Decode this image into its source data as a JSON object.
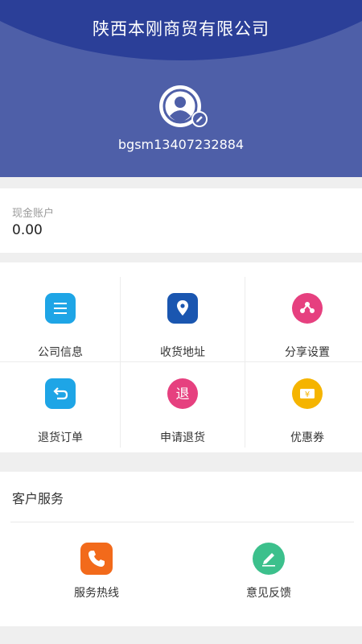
{
  "header": {
    "title": "陕西本刚商贸有限公司",
    "username": "bgsm13407232884"
  },
  "account": {
    "label": "现金账户",
    "value": "0.00"
  },
  "menu": [
    {
      "label": "公司信息",
      "icon": "document-lines-icon",
      "color": "#1ea5e6"
    },
    {
      "label": "收货地址",
      "icon": "location-pin-icon",
      "color": "#1a56b0"
    },
    {
      "label": "分享设置",
      "icon": "share-icon",
      "color": "#e6407f"
    },
    {
      "label": "退货订单",
      "icon": "return-arrow-icon",
      "color": "#1ea5e6"
    },
    {
      "label": "申请退货",
      "icon": "return-char-icon",
      "glyph": "退",
      "color": "#e6407f"
    },
    {
      "label": "优惠券",
      "icon": "coupon-yen-icon",
      "glyph": "¥",
      "color": "#f5b400"
    }
  ],
  "service": {
    "title": "客户服务",
    "items": [
      {
        "label": "服务热线",
        "icon": "phone-icon",
        "color": "#f26a1b"
      },
      {
        "label": "意见反馈",
        "icon": "pencil-icon",
        "color": "#3cc08c"
      }
    ]
  }
}
